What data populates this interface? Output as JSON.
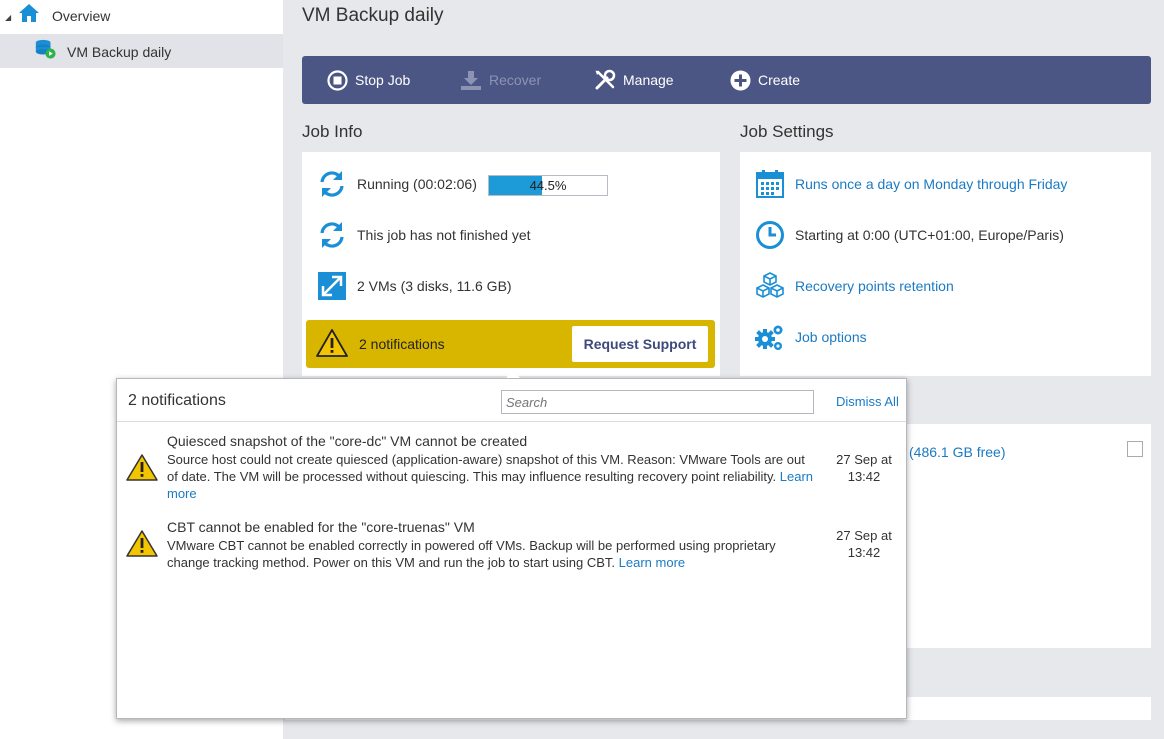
{
  "sidebar": {
    "items": [
      {
        "label": "Overview",
        "icon": "home-icon"
      },
      {
        "label": "VM Backup daily",
        "icon": "vm-backup-job-icon"
      }
    ]
  },
  "page": {
    "title": "VM Backup daily"
  },
  "toolbar": {
    "stop_label": "Stop Job",
    "recover_label": "Recover",
    "manage_label": "Manage",
    "create_label": "Create"
  },
  "job_info": {
    "title": "Job Info",
    "status": "Running (00:02:06)",
    "progress_percent": 44.5,
    "progress_label": "44.5%",
    "last_run": "This job has not finished yet",
    "vms": "2 VMs (3 disks, 11.6 GB)",
    "notifications_label": "2 notifications",
    "request_support": "Request Support"
  },
  "job_settings": {
    "title": "Job Settings",
    "schedule": "Runs once a day on Monday through Friday",
    "start_time": "Starting at 0:00 (UTC+01:00, Europe/Paris)",
    "retention": "Recovery points retention",
    "options": "Job options"
  },
  "background": {
    "storage_free": "(486.1 GB free)",
    "partial_paren": ")"
  },
  "popup": {
    "title": "2 notifications",
    "search_placeholder": "Search",
    "dismiss_all": "Dismiss All",
    "items": [
      {
        "title": "Quiesced snapshot of the \"core-dc\" VM cannot be created",
        "body": "Source host could not create quiesced (application-aware) snapshot of this VM. Reason: VMware Tools are out of date. The VM will be processed without quiescing. This may influence resulting recovery point reliability.",
        "link": "Learn more",
        "date": "27 Sep at",
        "time": "13:42"
      },
      {
        "title": "CBT cannot be enabled for the \"core-truenas\" VM",
        "body": "VMware CBT cannot be enabled correctly in powered off VMs. Backup will be performed using proprietary change tracking method. Power on this VM and run the job to start using CBT.",
        "link": "Learn more",
        "date": "27 Sep at",
        "time": "13:42"
      }
    ]
  },
  "colors": {
    "toolbar_bg": "#4c5685",
    "accent_blue": "#1a7bc4",
    "notification_yellow": "#d8b600",
    "progress_blue": "#1d9ad8",
    "warning_yellow": "#f3c400"
  }
}
